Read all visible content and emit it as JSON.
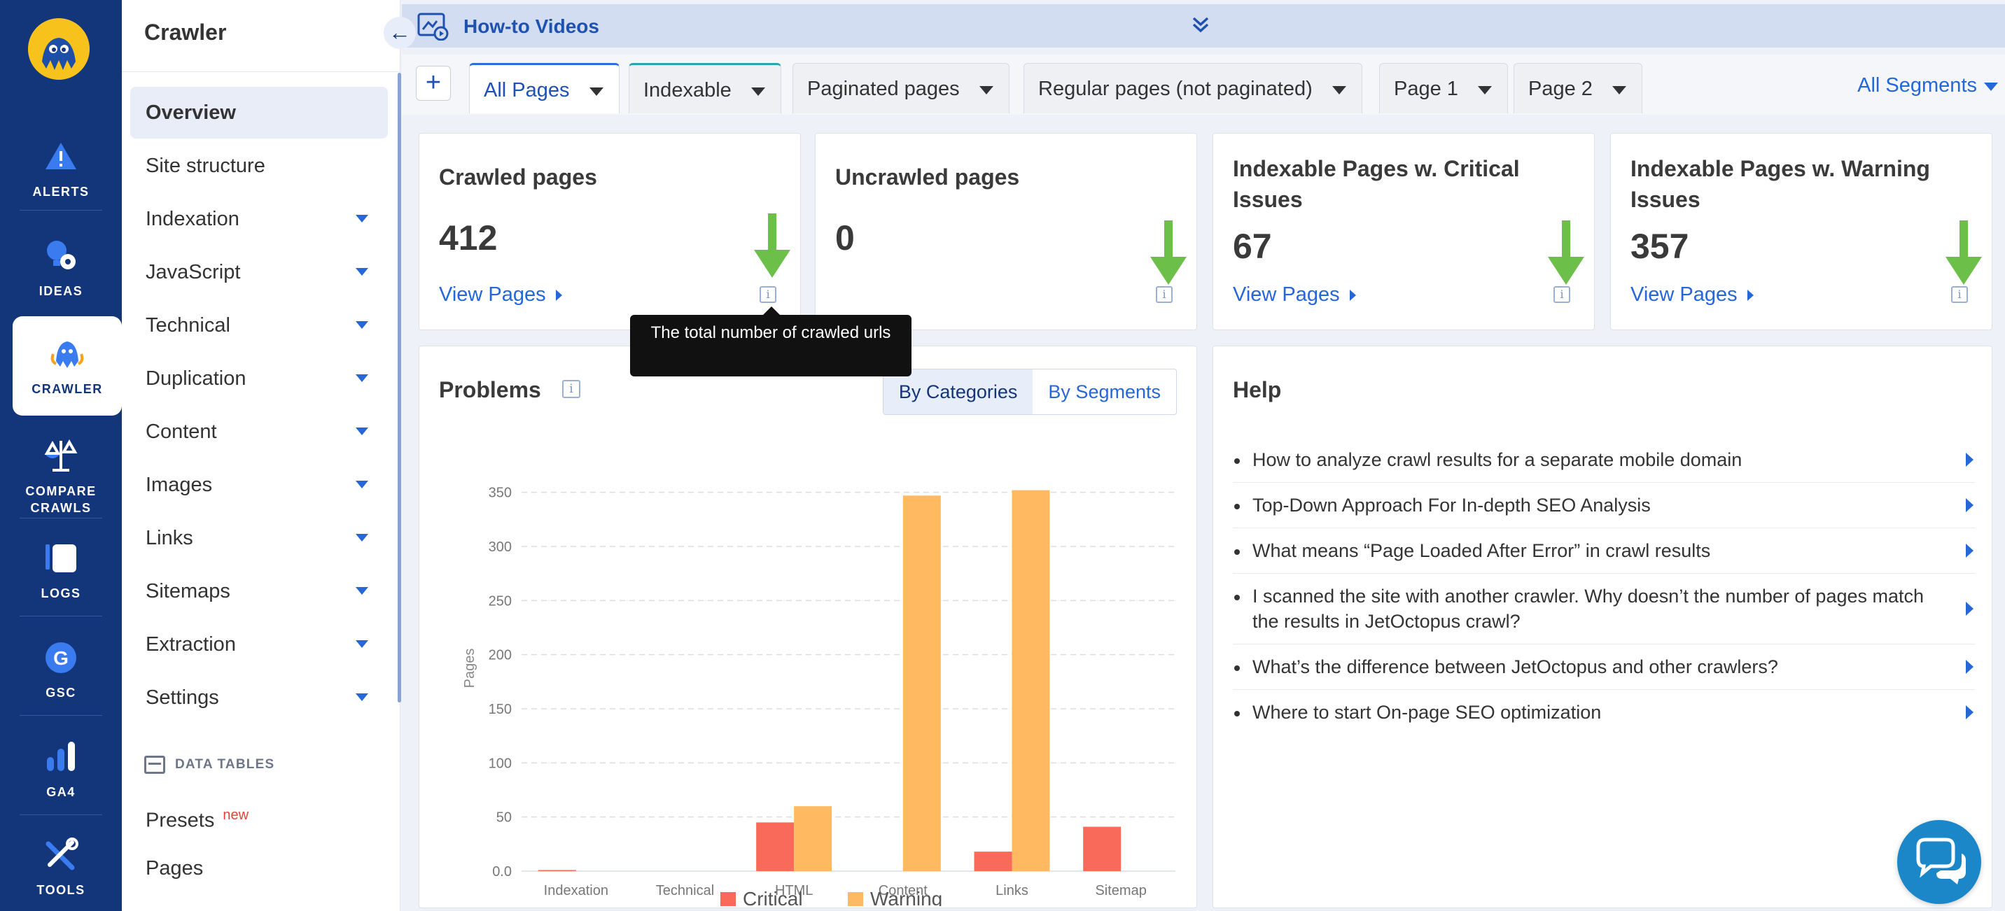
{
  "rail": {
    "items": [
      {
        "label": "ALERTS",
        "icon": "alert-icon"
      },
      {
        "label": "IDEAS",
        "icon": "idea-gear-icon"
      },
      {
        "label": "CRAWLER",
        "icon": "octopus-icon",
        "active": true
      },
      {
        "label": "COMPARE CRAWLS",
        "icon": "scales-icon"
      },
      {
        "label": "LOGS",
        "icon": "logs-icon"
      },
      {
        "label": "GSC",
        "icon": "google-icon"
      },
      {
        "label": "GA4",
        "icon": "analytics-bars-icon"
      },
      {
        "label": "TOOLS",
        "icon": "tools-icon"
      }
    ]
  },
  "sidebar": {
    "title": "Crawler",
    "items": [
      {
        "label": "Overview",
        "active": true
      },
      {
        "label": "Site structure"
      },
      {
        "label": "Indexation",
        "caret": true
      },
      {
        "label": "JavaScript",
        "caret": true
      },
      {
        "label": "Technical",
        "caret": true
      },
      {
        "label": "Duplication",
        "caret": true
      },
      {
        "label": "Content",
        "caret": true
      },
      {
        "label": "Images",
        "caret": true
      },
      {
        "label": "Links",
        "caret": true
      },
      {
        "label": "Sitemaps",
        "caret": true
      },
      {
        "label": "Extraction",
        "caret": true
      },
      {
        "label": "Settings",
        "caret": true
      }
    ],
    "section_label": "DATA TABLES",
    "presets_label": "Presets",
    "presets_badge": "new",
    "pages_label": "Pages"
  },
  "banner": {
    "title": "How-to Videos"
  },
  "segments": {
    "add_label": "+",
    "tabs": [
      {
        "label": "All Pages",
        "active": true
      },
      {
        "label": "Indexable"
      },
      {
        "label": "Paginated pages"
      },
      {
        "label": "Regular pages (not paginated)"
      },
      {
        "label": "Page 1"
      },
      {
        "label": "Page 2"
      }
    ],
    "all_segments_label": "All Segments"
  },
  "kpis": [
    {
      "title": "Crawled pages",
      "value": "412",
      "link": "View Pages"
    },
    {
      "title": "Uncrawled pages",
      "value": "0",
      "link": ""
    },
    {
      "title": "Indexable Pages w. Critical Issues",
      "value": "67",
      "link": "View Pages"
    },
    {
      "title": "Indexable Pages w. Warning Issues",
      "value": "357",
      "link": "View Pages"
    }
  ],
  "tooltip": {
    "text": "The total number of crawled urls"
  },
  "info_glyph": "i",
  "problems": {
    "title": "Problems",
    "toggle": {
      "by_categories": "By Categories",
      "by_segments": "By Segments"
    }
  },
  "chart_data": {
    "type": "bar",
    "categories": [
      "Indexation",
      "Technical",
      "HTML",
      "Content",
      "Links",
      "Sitemap"
    ],
    "series": [
      {
        "name": "Critical",
        "color": "#f96a5b",
        "values": [
          1,
          0,
          45,
          0,
          18,
          41
        ]
      },
      {
        "name": "Warning",
        "color": "#ffb960",
        "values": [
          0,
          0,
          60,
          347,
          352,
          0
        ]
      }
    ],
    "ylabel": "Pages",
    "yticks": [
      "0.0",
      "50",
      "100",
      "150",
      "200",
      "250",
      "300",
      "350"
    ],
    "ylim": [
      0,
      375
    ],
    "grid": true,
    "legend": "bottom"
  },
  "help": {
    "title": "Help",
    "items": [
      "How to analyze crawl results for a separate mobile domain",
      "Top-Down Approach For In-depth SEO Analysis",
      "What means “Page Loaded After Error” in crawl results",
      "I scanned the site with another crawler. Why doesn’t the number of pages match the results in JetOctopus crawl?",
      "What’s the difference between JetOctopus and other crawlers?",
      "Where to start On-page SEO optimization"
    ]
  },
  "colors": {
    "rail": "#13357a",
    "accent": "#2567d6",
    "arrow": "#6cc04a",
    "critical": "#f96a5b",
    "warning": "#ffb960"
  }
}
